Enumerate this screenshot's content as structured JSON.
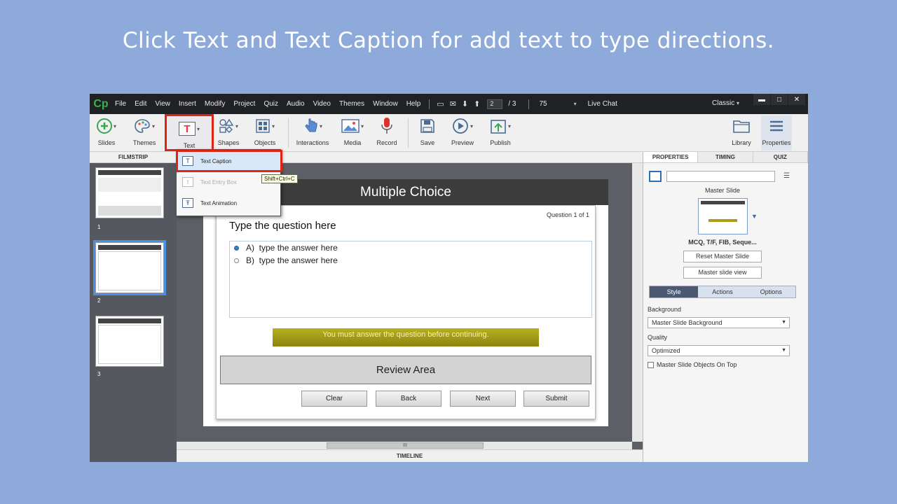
{
  "slide_title": "Click Text and Text Caption for add text to type directions.",
  "app": {
    "logo": "Cp",
    "menu": [
      "File",
      "Edit",
      "View",
      "Insert",
      "Modify",
      "Project",
      "Quiz",
      "Audio",
      "Video",
      "Themes",
      "Window",
      "Help"
    ],
    "page_current": "2",
    "page_total": "/ 3",
    "zoom": "75",
    "live_chat": "Live Chat",
    "workspace": "Classic",
    "toolbar": {
      "slides": "Slides",
      "themes": "Themes",
      "text": "Text",
      "shapes": "Shapes",
      "objects": "Objects",
      "interactions": "Interactions",
      "media": "Media",
      "record": "Record",
      "save": "Save",
      "preview": "Preview",
      "publish": "Publish",
      "library": "Library",
      "properties": "Properties"
    },
    "text_menu": {
      "items": [
        "Text Caption",
        "Text Entry Box",
        "Text Animation"
      ],
      "tooltip": "Shift+Ctrl+C"
    },
    "filmstrip": {
      "header": "FILMSTRIP",
      "numbers": [
        "1",
        "2",
        "3"
      ]
    },
    "slide": {
      "header": "Multiple Choice",
      "counter": "Question 1 of 1",
      "question": "Type the question here",
      "answers": [
        {
          "letter": "A)",
          "text": "type the answer here"
        },
        {
          "letter": "B)",
          "text": "type the answer here"
        }
      ],
      "warning": "You must answer the question before continuing.",
      "review": "Review Area",
      "buttons": [
        "Clear",
        "Back",
        "Next",
        "Submit"
      ]
    },
    "timeline": "TIMELINE",
    "scroll_grip": "III",
    "properties": {
      "tabs": [
        "PROPERTIES",
        "TIMING",
        "QUIZ"
      ],
      "master_slide_label": "Master Slide",
      "master_name": "MCQ, T/F, FIB, Seque...",
      "reset_btn": "Reset Master Slide",
      "view_btn": "Master slide view",
      "style_tabs": [
        "Style",
        "Actions",
        "Options"
      ],
      "background_label": "Background",
      "background_value": "Master Slide Background",
      "quality_label": "Quality",
      "quality_value": "Optimized",
      "checkbox_label": "Master Slide Objects On Top"
    }
  },
  "colors": {
    "page_bg": "#8eaadb",
    "highlight": "#e02414",
    "accent": "#4a90e2"
  }
}
